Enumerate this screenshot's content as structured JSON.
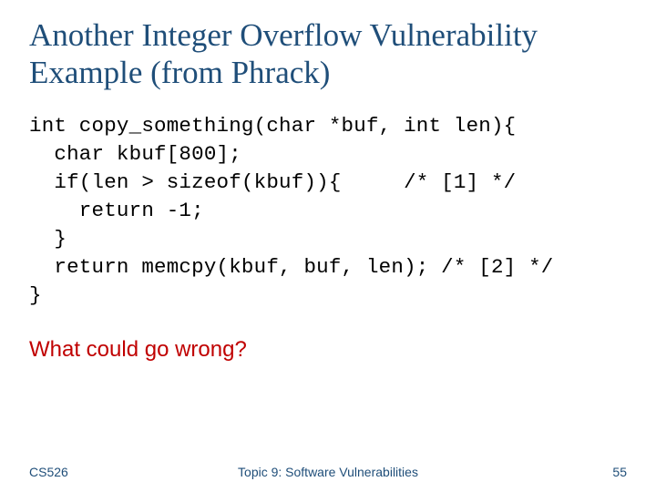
{
  "title": "Another Integer Overflow Vulnerability Example (from Phrack)",
  "code": {
    "line1": "int copy_something(char *buf, int len){",
    "line2": "  char kbuf[800];",
    "line3": "  if(len > sizeof(kbuf)){     /* [1] */",
    "line4": "    return -1;",
    "line5": "  }",
    "line6": "  return memcpy(kbuf, buf, len); /* [2] */",
    "line7": "}"
  },
  "question": "What could go wrong?",
  "footer": {
    "left": "CS526",
    "center": "Topic 9: Software Vulnerabilities",
    "right": "55"
  }
}
